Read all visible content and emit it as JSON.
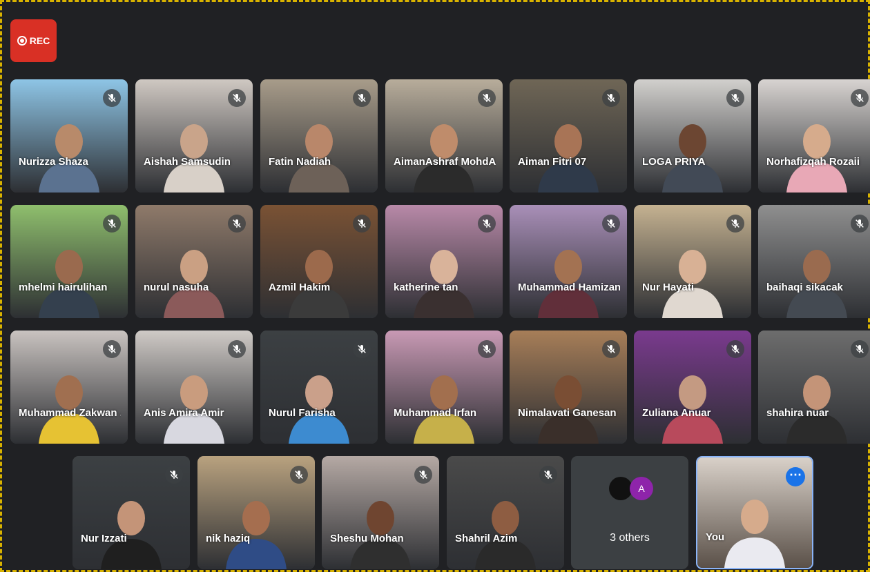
{
  "recording": {
    "label": "REC"
  },
  "participants": [
    {
      "name": "Nurizza Shaza",
      "bg": "#8ec5e6",
      "skin": "#b88a6a",
      "outfit": "#5b7290"
    },
    {
      "name": "Aishah Samsudin",
      "bg": "#cfc8c2",
      "skin": "#c9a48a",
      "outfit": "#d8d0c8"
    },
    {
      "name": "Fatin Nadiah",
      "bg": "#a89c8a",
      "skin": "#b9876a",
      "outfit": "#6d6158"
    },
    {
      "name": "AimanAshraf MohdA...",
      "bg": "#b8ad9b",
      "skin": "#bf8c6b",
      "outfit": "#2b2b2b"
    },
    {
      "name": "Aiman Fitri 07",
      "bg": "#6f6656",
      "skin": "#a87456",
      "outfit": "#2f3a4a"
    },
    {
      "name": "LOGA PRIYA",
      "bg": "#d2d0cd",
      "skin": "#6c4632",
      "outfit": "#424a56"
    },
    {
      "name": "Norhafizqah Rozaii",
      "bg": "#d8d4d1",
      "skin": "#d6ab8c",
      "outfit": "#e8a8b6"
    },
    {
      "name": "mhelmi hairulihan",
      "bg": "#8fbf6d",
      "skin": "#9a6a4e",
      "outfit": "#34404e"
    },
    {
      "name": "nurul nasuha",
      "bg": "#8f7a6a",
      "skin": "#caa083",
      "outfit": "#8b5a5a"
    },
    {
      "name": "Azmil Hakim",
      "bg": "#7a5234",
      "skin": "#9c6a4c",
      "outfit": "#3b3b3b"
    },
    {
      "name": "katherine tan",
      "bg": "#b889a8",
      "skin": "#d9b39a",
      "outfit": "#3a3030"
    },
    {
      "name": "Muhammad Hamizan",
      "bg": "#a98fb8",
      "skin": "#a37252",
      "outfit": "#612f3a"
    },
    {
      "name": "Nur Hayati",
      "bg": "#c5b291",
      "skin": "#d8b195",
      "outfit": "#e0d8d0"
    },
    {
      "name": "baihaqi sikacak",
      "bg": "#8f8f8f",
      "skin": "#9a6b4f",
      "outfit": "#444a52"
    },
    {
      "name": "Muhammad Zakwan ...",
      "bg": "#c9c3c0",
      "skin": "#a06f50",
      "outfit": "#e6c233"
    },
    {
      "name": "Anis Amira Amir",
      "bg": "#cfcac6",
      "skin": "#c99c7e",
      "outfit": "#d8d8e0"
    },
    {
      "name": "Nurul Farisha",
      "bg": "#3c4043",
      "skin": "#caa08a",
      "outfit": "#3d8bd0"
    },
    {
      "name": "Muhammad Irfan",
      "bg": "#c899b4",
      "skin": "#a26f4e",
      "outfit": "#c6b04a"
    },
    {
      "name": "Nimalavati Ganesan",
      "bg": "#a77e58",
      "skin": "#7a4e34",
      "outfit": "#3a2f2a"
    },
    {
      "name": "Zuliana Anuar",
      "bg": "#7a3a8e",
      "skin": "#c49a82",
      "outfit": "#b84a5c"
    },
    {
      "name": "shahira nuar",
      "bg": "#6d6d6d",
      "skin": "#c49478",
      "outfit": "#2b2b2b"
    },
    {
      "name": "Nur Izzati",
      "bg": "#3c4043",
      "skin": "#c49478",
      "outfit": "#1f1f1f"
    },
    {
      "name": "nik haziq",
      "bg": "#b9a27f",
      "skin": "#a56e4f",
      "outfit": "#2f4c86"
    },
    {
      "name": "Sheshu Mohan",
      "bg": "#b5a9a4",
      "skin": "#6f4530",
      "outfit": "#2f2f2f"
    },
    {
      "name": "Shahril Azim",
      "bg": "#4a4a4a",
      "skin": "#8e5d42",
      "outfit": "#2a2a2a"
    }
  ],
  "others": {
    "label": "3 others",
    "avatars": [
      {
        "letter": "",
        "color": "#111111"
      },
      {
        "letter": "A",
        "color": "#8e24aa"
      }
    ]
  },
  "self_tile": {
    "name": "You",
    "bg": "#d9d1c9",
    "skin": "#d6ab8c",
    "outfit": "#eaeaf0"
  },
  "colors": {
    "background": "#202124",
    "tile": "#3c4043",
    "rec": "#d93025",
    "accent": "#1a73e8"
  },
  "icons": {
    "mute": "microphone-off-icon",
    "more": "more-options-icon",
    "rec": "record-icon"
  }
}
